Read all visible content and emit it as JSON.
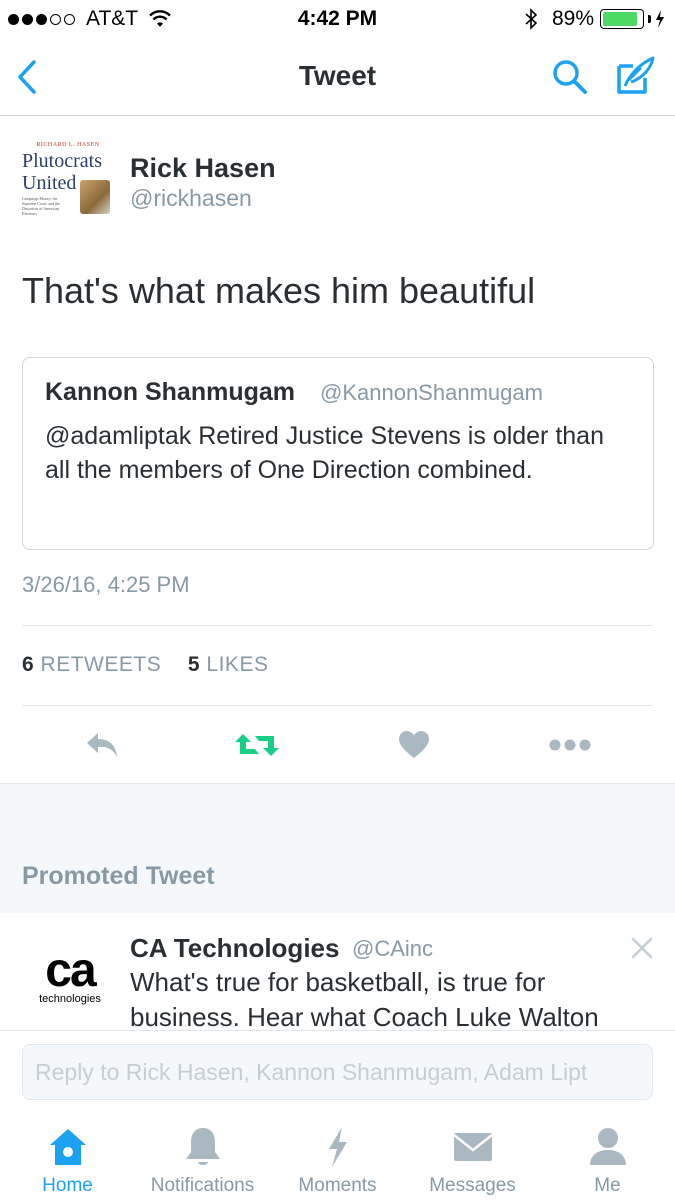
{
  "status_bar": {
    "carrier": "AT&T",
    "time": "4:42 PM",
    "battery_percent": "89%",
    "signal_bars_filled": 3,
    "signal_bars_total": 5,
    "battery_level": 0.89
  },
  "nav": {
    "title": "Tweet",
    "back_icon": "chevron-left-icon",
    "search_icon": "search-icon",
    "compose_icon": "compose-icon"
  },
  "tweet": {
    "avatar_book": {
      "author": "RICHARD L. HASEN",
      "title_line1": "Plutocrats",
      "title_line2": "United",
      "subtitle": "Campaign Money, the Supreme Court, and the Distortion of American Elections"
    },
    "user_name": "Rick Hasen",
    "user_handle": "@rickhasen",
    "text": "That's what makes him beautiful",
    "quoted": {
      "user_name": "Kannon Shanmugam",
      "user_handle": "@KannonShanmugam",
      "text": "@adamliptak Retired Justice Stevens is older than all the members of One Direction combined."
    },
    "timestamp": "3/26/16, 4:25 PM",
    "retweet_count": "6",
    "retweet_label": "RETWEETS",
    "like_count": "5",
    "like_label": "LIKES"
  },
  "actions": [
    {
      "icon": "reply-icon",
      "color": "#aab8c2"
    },
    {
      "icon": "retweet-icon",
      "color": "#19cf86"
    },
    {
      "icon": "heart-icon",
      "color": "#aab8c2"
    },
    {
      "icon": "more-icon",
      "color": "#aab8c2"
    }
  ],
  "promoted": {
    "section_label": "Promoted Tweet",
    "logo_text": "ca",
    "logo_subtext": "technologies",
    "user_name": "CA Technologies",
    "user_handle": "@CAinc",
    "text": "What's true for basketball, is true for business. Hear what Coach Luke Walton"
  },
  "reply": {
    "placeholder": "Reply to Rick Hasen, Kannon Shanmugam, Adam Lipt"
  },
  "tabs": [
    {
      "label": "Home",
      "icon": "home-icon",
      "active": true
    },
    {
      "label": "Notifications",
      "icon": "bell-icon",
      "active": false
    },
    {
      "label": "Moments",
      "icon": "lightning-icon",
      "active": false
    },
    {
      "label": "Messages",
      "icon": "envelope-icon",
      "active": false
    },
    {
      "label": "Me",
      "icon": "person-icon",
      "active": false
    }
  ],
  "colors": {
    "accent": "#1da1f2",
    "retweet_active": "#19cf86",
    "muted": "#8899a6",
    "icon_gray": "#aab8c2",
    "text": "#292f33",
    "battery": "#4cd964"
  }
}
